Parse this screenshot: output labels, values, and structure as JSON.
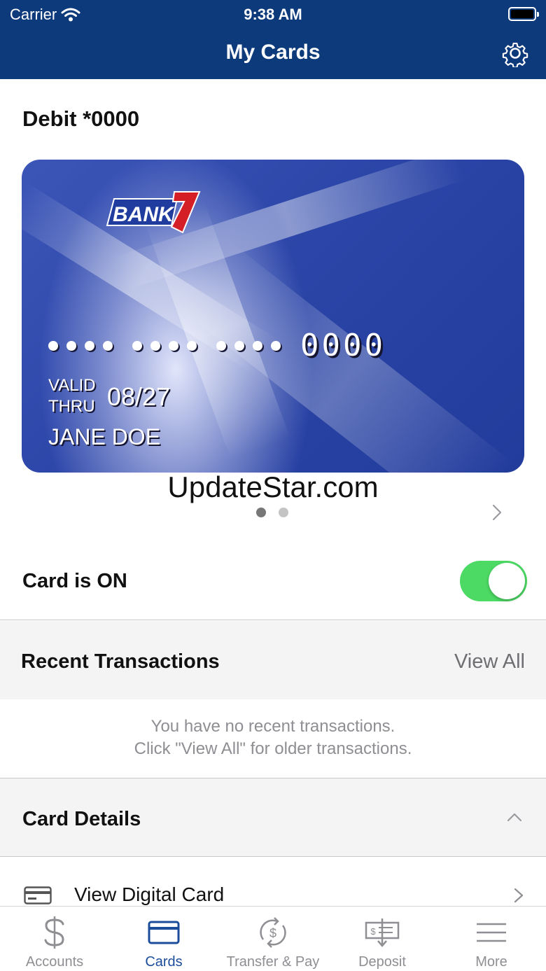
{
  "status_bar": {
    "carrier": "Carrier",
    "time": "9:38 AM"
  },
  "header": {
    "title": "My Cards",
    "settings_icon": "gear-icon"
  },
  "card": {
    "label": "Debit *0000",
    "brand": "BANK7",
    "last4": "0000",
    "valid_line1": "VALID",
    "valid_line2": "THRU",
    "expiry": "08/27",
    "holder": "JANE DOE",
    "pager": {
      "count": 2,
      "active_index": 0
    }
  },
  "watermark": "UpdateStar.com",
  "card_status": {
    "label": "Card is ON",
    "enabled": true
  },
  "recent_transactions": {
    "title": "Recent Transactions",
    "view_all": "View All",
    "empty_line1": "You have no recent transactions.",
    "empty_line2": "Click \"View All\" for older transactions."
  },
  "card_details": {
    "title": "Card Details",
    "items": [
      {
        "label": "View Digital Card",
        "icon": "credit-card-icon"
      }
    ]
  },
  "tabbar": {
    "tabs": [
      {
        "label": "Accounts",
        "icon": "dollar-icon",
        "active": false
      },
      {
        "label": "Cards",
        "icon": "card-icon",
        "active": true
      },
      {
        "label": "Transfer & Pay",
        "icon": "transfer-icon",
        "active": false
      },
      {
        "label": "Deposit",
        "icon": "deposit-icon",
        "active": false
      },
      {
        "label": "More",
        "icon": "menu-icon",
        "active": false
      }
    ]
  },
  "colors": {
    "header": "#0d3a7a",
    "toggle_on": "#4cd964",
    "active_tab": "#1c4d9b",
    "inactive_tab": "#8e8e93"
  }
}
